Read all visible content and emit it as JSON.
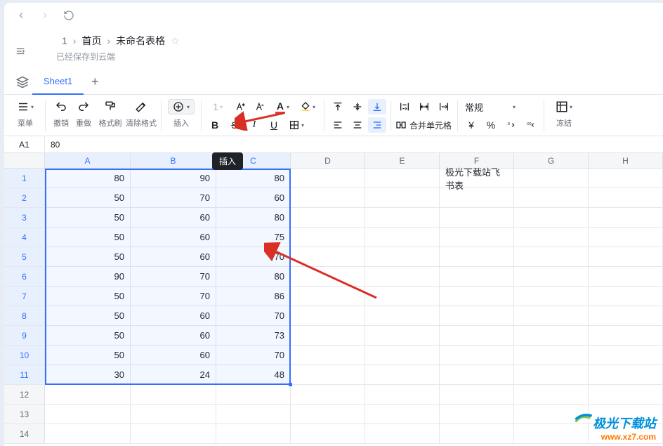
{
  "titlebar": {
    "back": "‹",
    "fwd": "›",
    "reload": "⟳"
  },
  "breadcrumb": {
    "num": "1",
    "home": "首页",
    "doc": "未命名表格"
  },
  "saved_text": "已经保存到云端",
  "sheet_tab": "Sheet1",
  "toolbar": {
    "menu": "菜单",
    "undo": "撤销",
    "redo": "重做",
    "fmt": "格式刷",
    "clr": "清除格式",
    "insert": "插入",
    "merge": "合并单元格",
    "general": "常规",
    "freeze": "冻结"
  },
  "tooltip_insert": "插入",
  "cell_ref": "A1",
  "cell_val": "80",
  "columns": [
    "A",
    "B",
    "C",
    "D",
    "E",
    "F",
    "G",
    "H"
  ],
  "col_widths": [
    "colA",
    "colB",
    "colC",
    "colD",
    "colE",
    "colF",
    "colG",
    "colH"
  ],
  "row_count": 14,
  "note_cell": "极光下载站飞书表",
  "data": [
    [
      80,
      90,
      80
    ],
    [
      50,
      70,
      60
    ],
    [
      50,
      60,
      80
    ],
    [
      50,
      60,
      75
    ],
    [
      50,
      60,
      70
    ],
    [
      90,
      70,
      80
    ],
    [
      50,
      70,
      86
    ],
    [
      50,
      60,
      70
    ],
    [
      50,
      60,
      73
    ],
    [
      50,
      60,
      70
    ],
    [
      30,
      24,
      48
    ]
  ],
  "watermark": {
    "line1": "极光下载站",
    "line2": "www.xz7.com"
  }
}
